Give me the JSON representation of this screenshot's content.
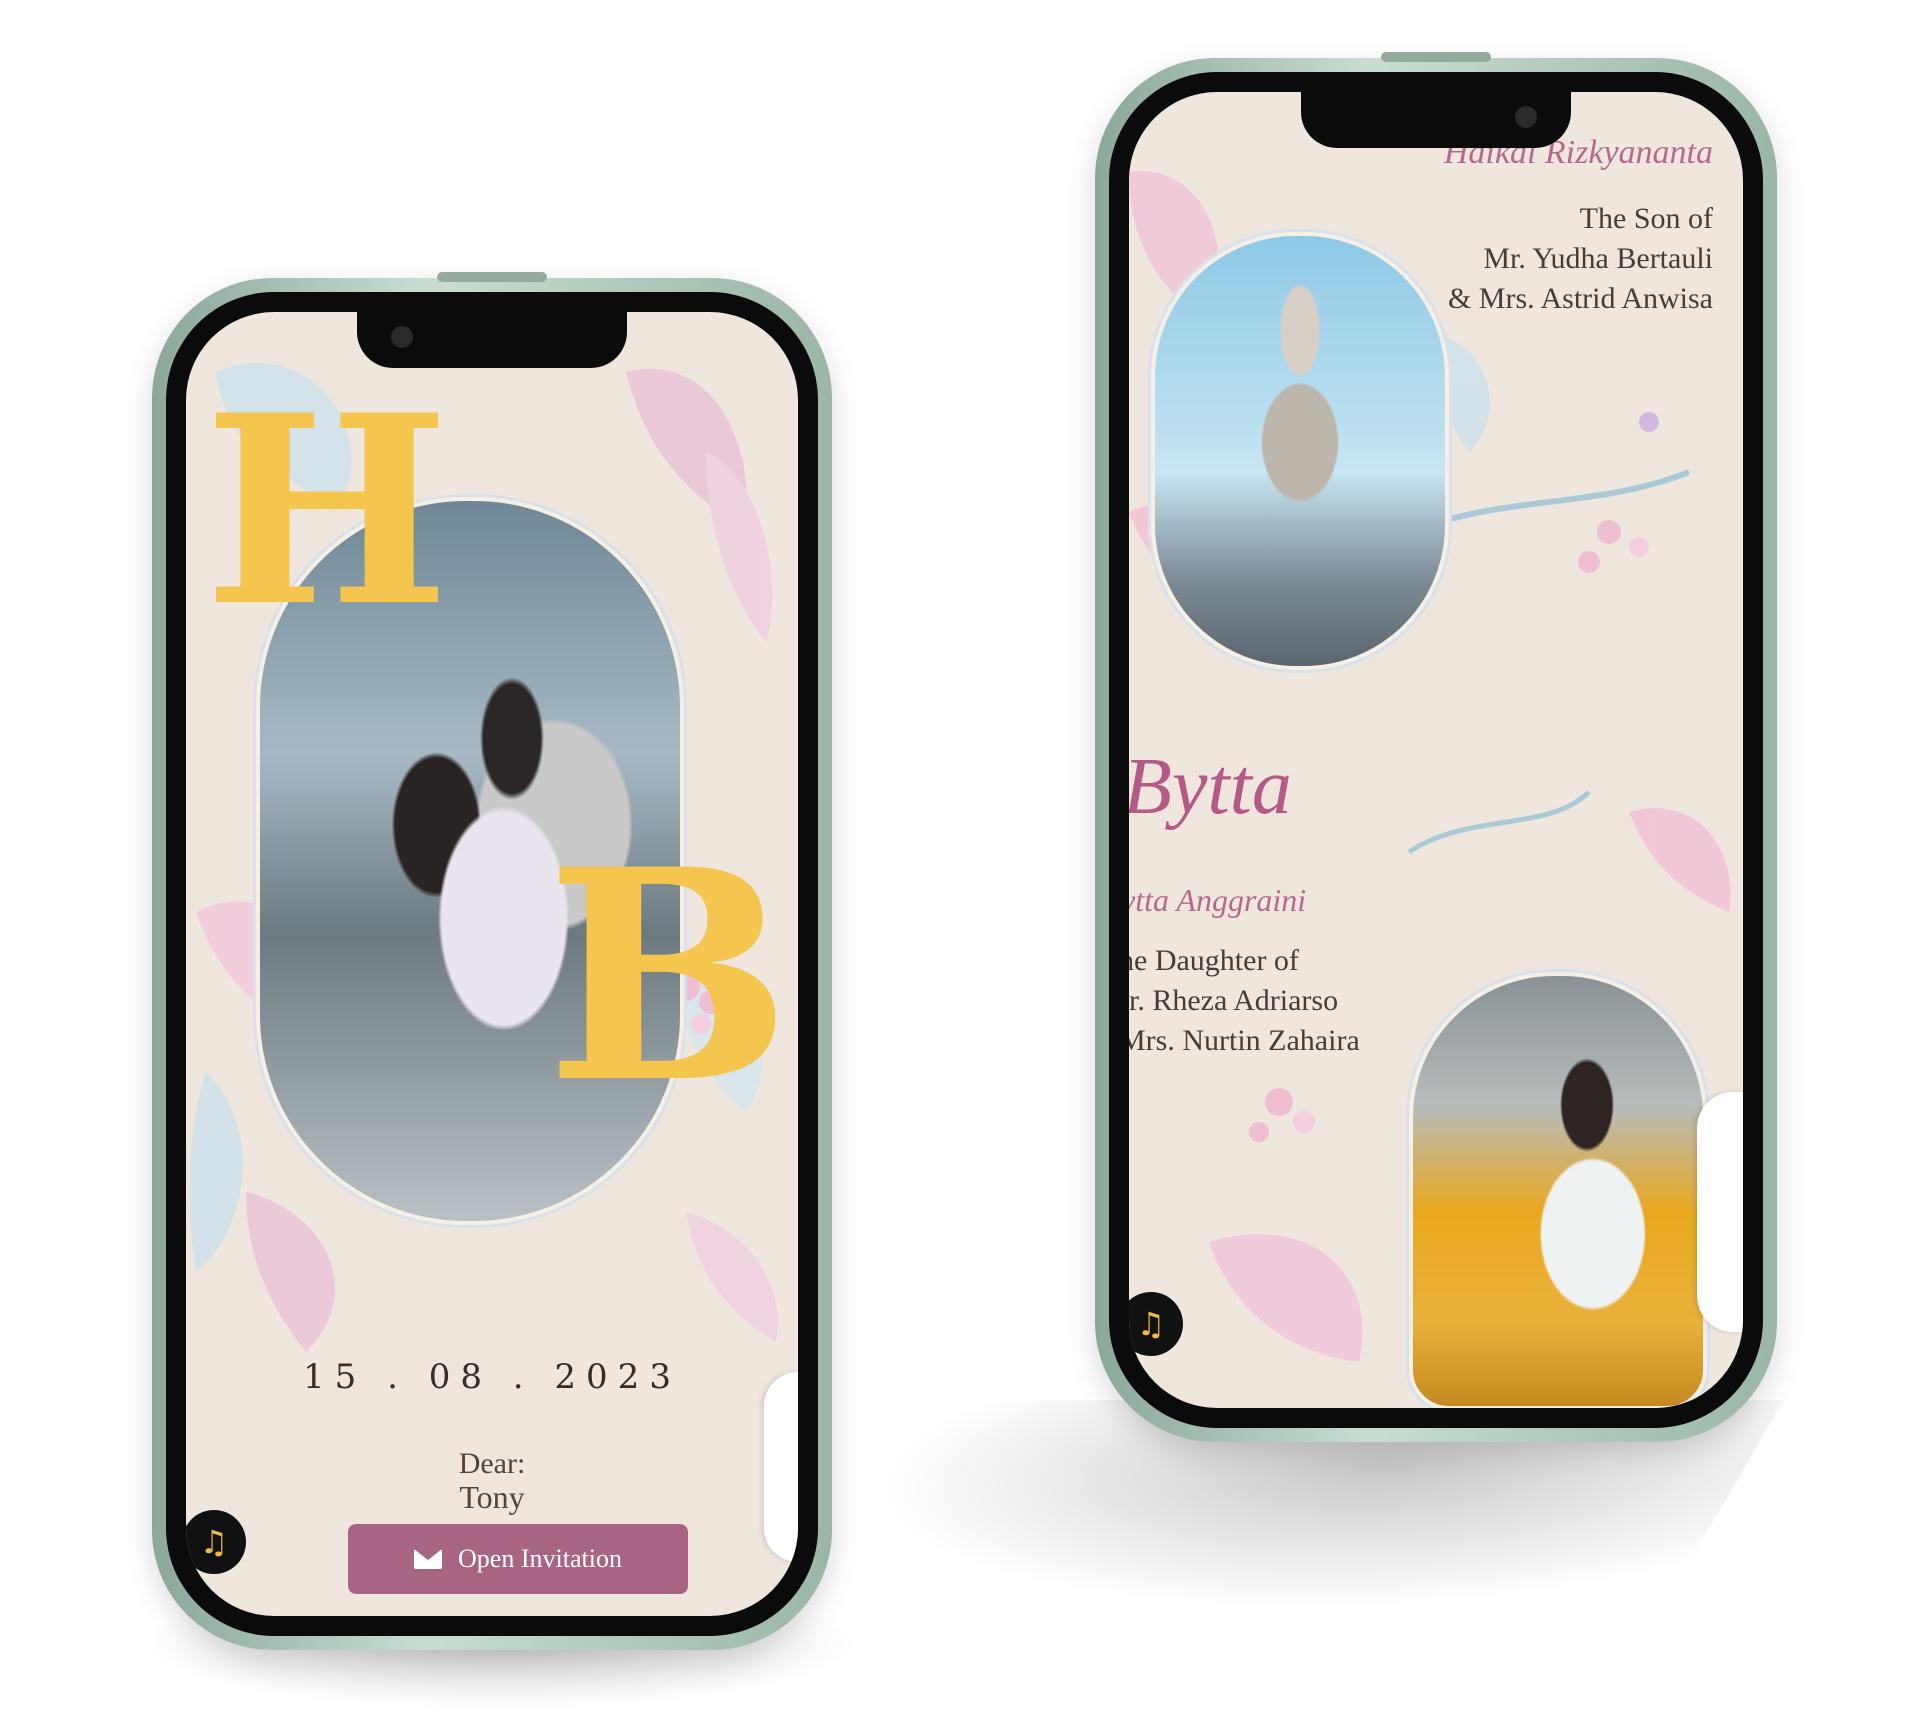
{
  "left_phone": {
    "monogram": {
      "first": "H",
      "second": "B"
    },
    "date": "15 . 08 . 2023",
    "dear_label": "Dear:",
    "guest_name": "Tony",
    "open_button_label": "Open Invitation",
    "icons": {
      "button": "envelope-icon",
      "music": "music-icon"
    },
    "colors": {
      "monogram": "#f5c64e",
      "button": "#a86583",
      "background": "#efe7de"
    }
  },
  "right_phone": {
    "groom": {
      "name": "Haikal Rizkyananta",
      "parent_lines": [
        "The Son of",
        "Mr. Yudha Bertauli",
        "& Mrs. Astrid Anwisa"
      ]
    },
    "bride": {
      "short_name": "Bytta",
      "full_name": "ytta Anggraini",
      "parent_lines": [
        "he Daughter of",
        "Ir. Rheza Adriarso",
        "Mrs. Nurtin Zahaira"
      ]
    },
    "icons": {
      "music": "music-icon"
    },
    "colors": {
      "name_accent": "#b56a8d",
      "background": "#efe7de"
    }
  }
}
